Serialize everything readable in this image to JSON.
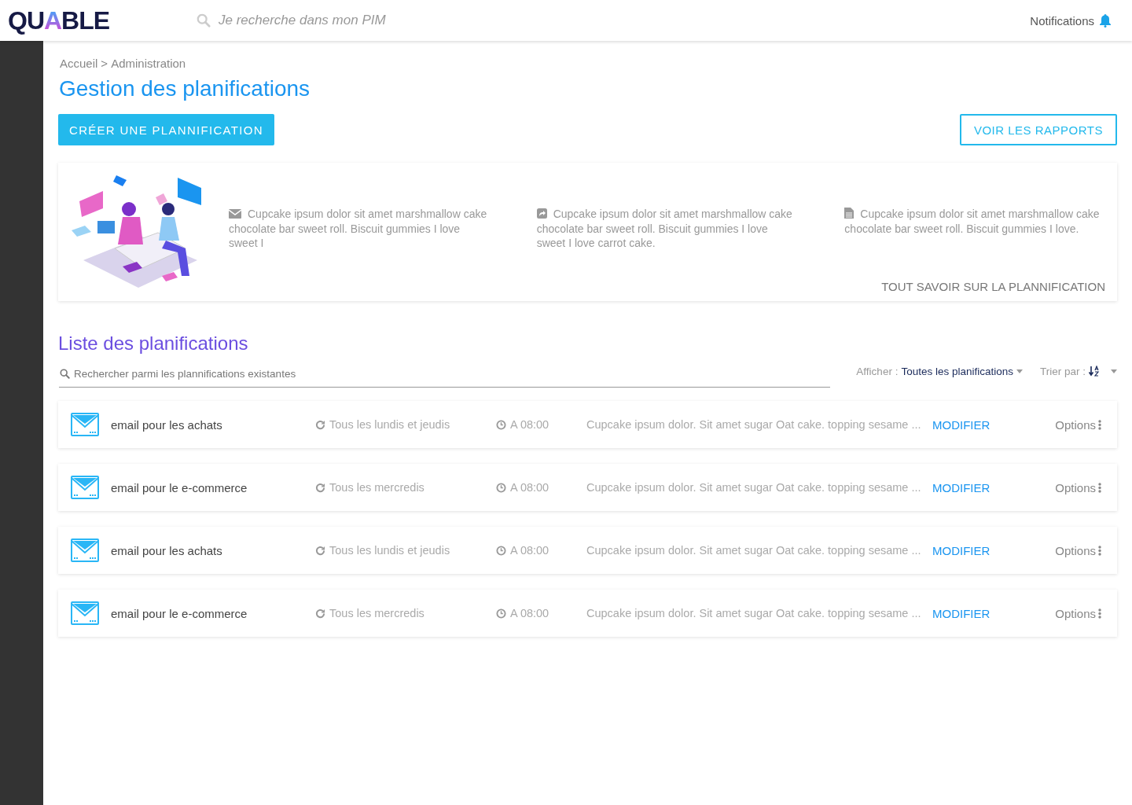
{
  "header": {
    "logo": "QUABLE",
    "search": {
      "placeholder": "Je recherche dans mon PIM"
    },
    "notifications": "Notifications"
  },
  "breadcrumb": [
    "Accueil",
    ">",
    "Administration"
  ],
  "title": "Gestion des planifications",
  "create_button": "CRÉER UNE PLANNIFICATION",
  "reports_button": "VOIR LES RAPPORTS",
  "info": {
    "items": [
      {
        "kind": "mail",
        "text": "Cupcake ipsum dolor sit amet marshmallow cake chocolate bar sweet roll. Biscuit gummies I love sweet I"
      },
      {
        "kind": "share",
        "text": "Cupcake ipsum dolor sit amet marshmallow cake chocolate bar sweet roll. Biscuit gummies I love sweet I love carrot cake."
      },
      {
        "kind": "file",
        "text": "Cupcake ipsum dolor sit amet marshmallow cake chocolate bar sweet roll. Biscuit gummies I love."
      }
    ],
    "link": "TOUT SAVOIR SUR LA PLANNIFICATION"
  },
  "list": {
    "title": "Liste des planifications",
    "search": {
      "placeholder": "Rechercher parmi les plannifications existantes"
    },
    "filter_label": "Afficher :",
    "filter_value": "Toutes les planifications",
    "sort_label": "Trier par :",
    "rows": [
      {
        "name": "email pour les achats",
        "recurrence": "Tous les lundis et jeudis",
        "time": "A 08:00",
        "description": "Cupcake ipsum dolor. Sit amet sugar Oat cake. topping sesame ...",
        "action": "MODIFIER",
        "options": "Options"
      },
      {
        "name": "email pour le e-commerce",
        "recurrence": "Tous les mercredis",
        "time": "A 08:00",
        "description": "Cupcake ipsum dolor. Sit amet sugar Oat cake. topping sesame ...",
        "action": "MODIFIER",
        "options": "Options"
      },
      {
        "name": "email pour les achats",
        "recurrence": "Tous les lundis et jeudis",
        "time": "A 08:00",
        "description": "Cupcake ipsum dolor. Sit amet sugar Oat cake. topping sesame ...",
        "action": "MODIFIER",
        "options": "Options"
      },
      {
        "name": "email pour le e-commerce",
        "recurrence": "Tous les mercredis",
        "time": "A 08:00",
        "description": "Cupcake ipsum dolor. Sit amet sugar Oat cake. topping sesame ...",
        "action": "MODIFIER",
        "options": "Options"
      }
    ]
  }
}
